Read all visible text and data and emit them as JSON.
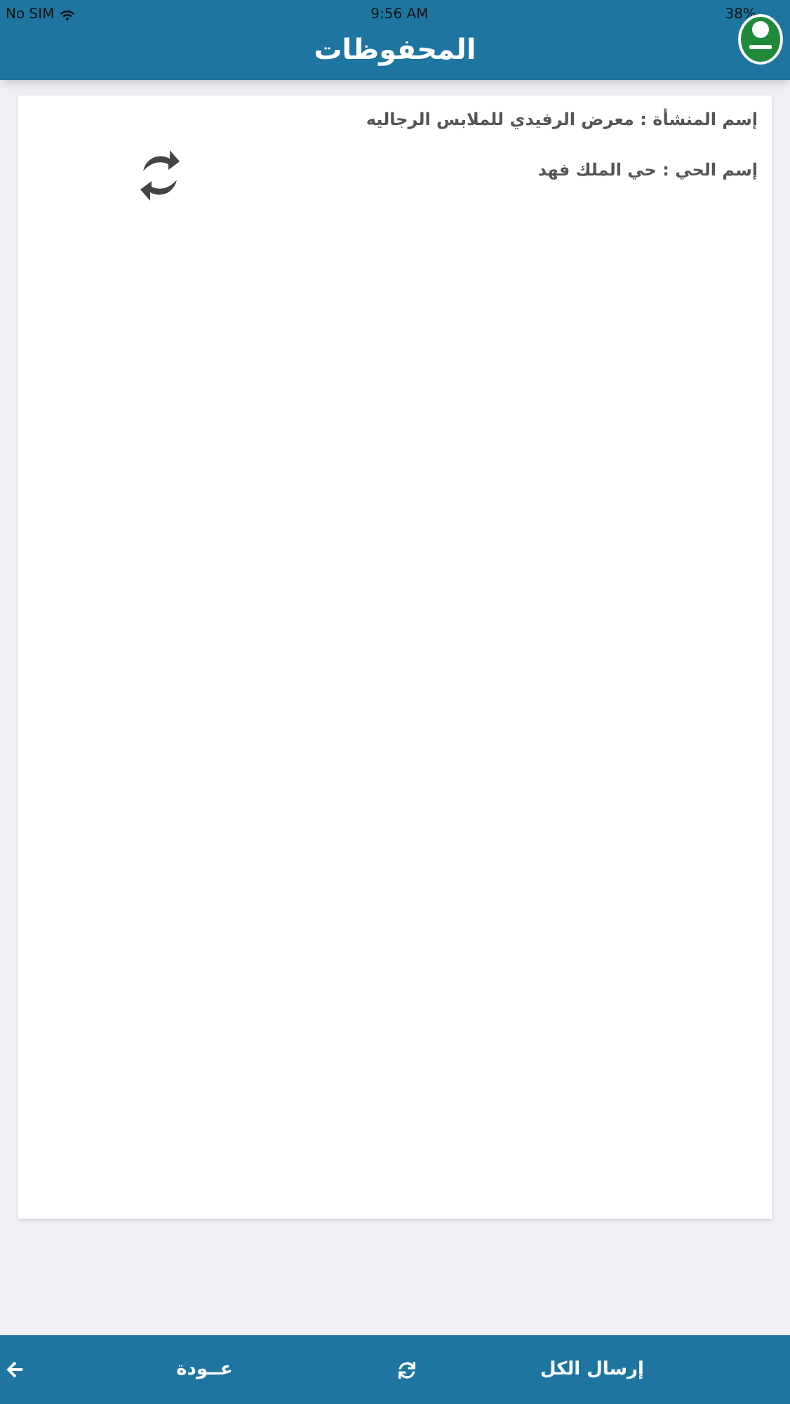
{
  "status_bar": {
    "carrier": "No SIM",
    "time": "9:56 AM",
    "battery": "38%"
  },
  "header": {
    "title": "المحفوظات"
  },
  "record": {
    "lines": [
      "إسم المنشأة : معرض الرفيدي للملابس الرجاليه",
      "إسم الحي : حي الملك فهد"
    ]
  },
  "bottom_bar": {
    "send_all": "إرسال الكل",
    "back": "عــودة"
  }
}
